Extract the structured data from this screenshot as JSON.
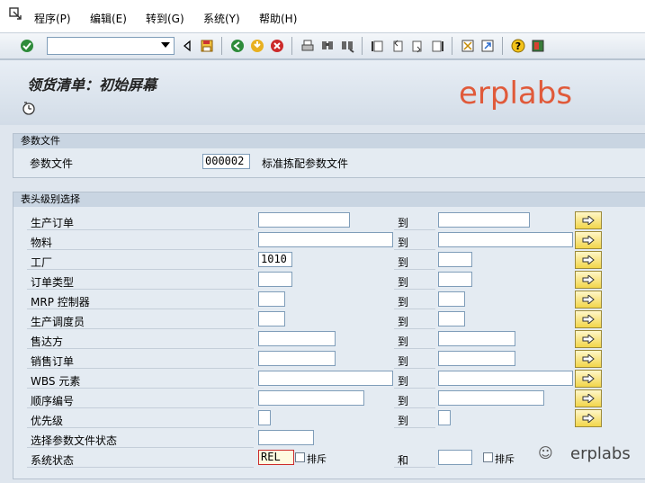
{
  "menu": [
    "程序(P)",
    "编辑(E)",
    "转到(G)",
    "系统(Y)",
    "帮助(H)"
  ],
  "screen_title": "领货清单：初始屏幕",
  "watermark_text": "erplabs",
  "wechat_text": "erplabs",
  "group1": {
    "header": "参数文件",
    "label": "参数文件",
    "value": "000002",
    "description": "标准拣配参数文件"
  },
  "group2": {
    "header": "表头级别选择",
    "to_label": "到",
    "and_label": "和",
    "rows": [
      {
        "label": "生产订单",
        "from": "",
        "to": ""
      },
      {
        "label": "物料",
        "from": "",
        "to": ""
      },
      {
        "label": "工厂",
        "from": "1010",
        "to": ""
      },
      {
        "label": "订单类型",
        "from": "",
        "to": ""
      },
      {
        "label": "MRP 控制器",
        "from": "",
        "to": ""
      },
      {
        "label": "生产调度员",
        "from": "",
        "to": ""
      },
      {
        "label": "售达方",
        "from": "",
        "to": ""
      },
      {
        "label": "销售订单",
        "from": "",
        "to": ""
      },
      {
        "label": "WBS 元素",
        "from": "",
        "to": ""
      },
      {
        "label": "顺序编号",
        "from": "",
        "to": ""
      },
      {
        "label": "优先级",
        "from": "",
        "to": ""
      },
      {
        "label": "选择参数文件状态",
        "from": ""
      },
      {
        "label": "系统状态",
        "from": "REL",
        "to": ""
      }
    ],
    "exclude_label": "排斥"
  },
  "colors": {
    "accent": "#e05a3a",
    "multisel": "#f2d64a"
  }
}
